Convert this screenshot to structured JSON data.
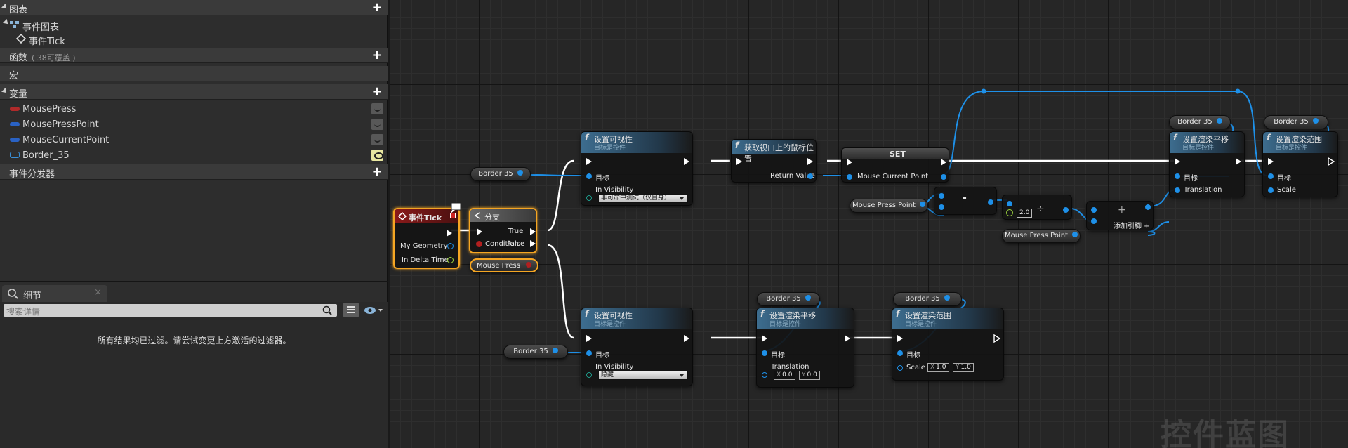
{
  "panel": {
    "graph_header": "图表",
    "event_graph": "事件图表",
    "event_tick": "事件Tick",
    "functions": "函数",
    "functions_count": "( 38可覆盖 )",
    "macros": "宏",
    "variables": "变量",
    "variable_items": [
      {
        "name": "MousePress",
        "color": "#b02a2a"
      },
      {
        "name": "MousePressPoint",
        "color": "#2a62c4"
      },
      {
        "name": "MouseCurrentPoint",
        "color": "#2a62c4"
      },
      {
        "name": "Border_35",
        "color": "#3a8fd6"
      }
    ],
    "event_dispatchers": "事件分发器"
  },
  "details": {
    "tab_label": "细节",
    "search_placeholder": "搜索详情",
    "message": "所有结果均已过滤。请尝试变更上方激活的过滤器。"
  },
  "graph": {
    "watermark": "控件蓝图",
    "event_tick": {
      "title": "事件Tick",
      "pin_geometry": "My Geometry",
      "pin_delta": "In Delta Time"
    },
    "branch": {
      "title": "分支",
      "pin_condition": "Condition",
      "pin_true": "True",
      "pin_false": "False"
    },
    "mouse_press_var": "Mouse Press",
    "border_var": "Border 35",
    "set_visibility_top": {
      "title": "设置可视性",
      "subtitle": "目标是控件",
      "pin_target": "目标",
      "pin_visibility": "In Visibility",
      "value": "非可命中测试（仅自身）"
    },
    "get_mouse_pos": {
      "title": "获取视口上的鼠标位置",
      "pin_return": "Return Value"
    },
    "set_node": {
      "title": "SET",
      "pin": "Mouse Current Point"
    },
    "mouse_press_point_var": "Mouse Press Point",
    "minus": "-",
    "divide": "÷",
    "divide_value": "2.0",
    "add": "+",
    "add_pin": "添加引脚",
    "set_translation_top": {
      "title": "设置渲染平移",
      "subtitle": "目标是控件",
      "pin_target": "目标",
      "pin_translation": "Translation"
    },
    "set_scale_top": {
      "title": "设置渲染范围",
      "subtitle": "目标是控件",
      "pin_target": "目标",
      "pin_scale": "Scale"
    },
    "set_visibility_bottom": {
      "title": "设置可视性",
      "subtitle": "目标是控件",
      "pin_target": "目标",
      "pin_visibility": "In Visibility",
      "value": "隐藏"
    },
    "set_translation_bottom": {
      "title": "设置渲染平移",
      "subtitle": "目标是控件",
      "pin_target": "目标",
      "pin_translation": "Translation",
      "x": "0.0",
      "y": "0.0"
    },
    "set_scale_bottom": {
      "title": "设置渲染范围",
      "subtitle": "目标是控件",
      "pin_target": "目标",
      "pin_scale": "Scale",
      "x": "1.0",
      "y": "1.0"
    },
    "axis_x": "X",
    "axis_y": "Y"
  },
  "colors": {
    "exec": "#ffffff",
    "object": "#1e90e8",
    "bool": "#b21f1f",
    "vector": "#f1c40f",
    "selection": "#f5a623"
  }
}
